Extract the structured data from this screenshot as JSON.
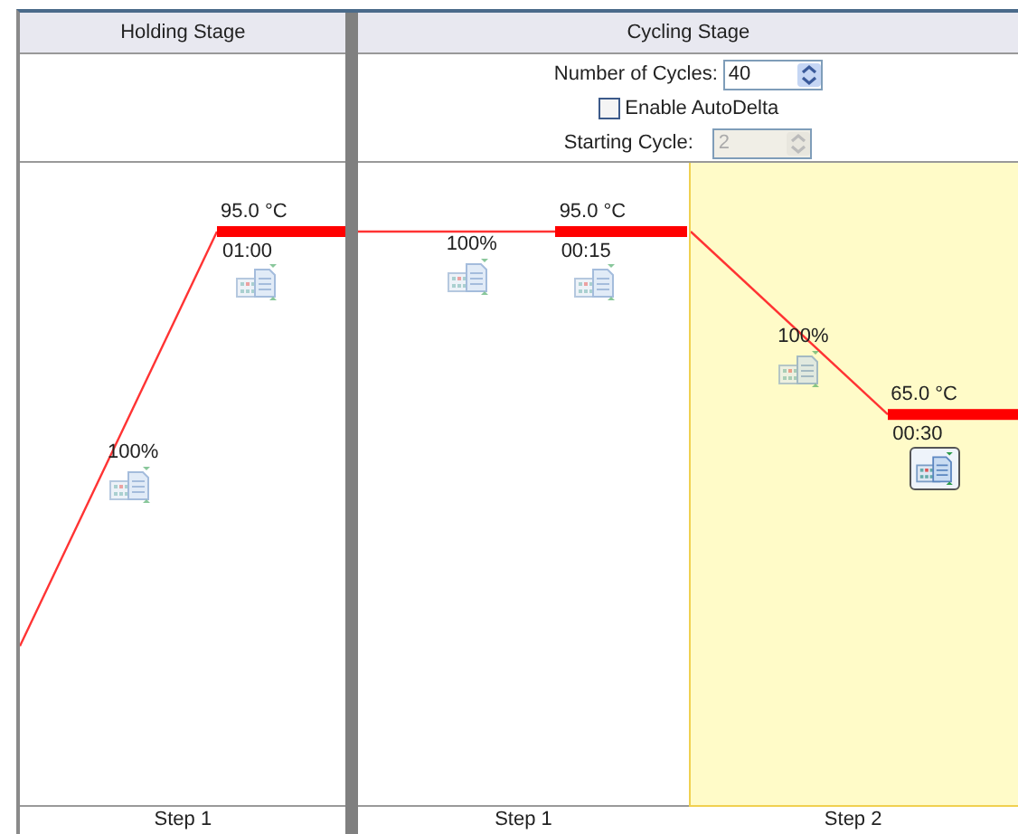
{
  "stages": [
    {
      "title": "Holding Stage",
      "steps": [
        {
          "label": "Step 1",
          "temperature": "95.0 °C",
          "time": "01:00",
          "ramp": "100%",
          "selected": false
        }
      ]
    },
    {
      "title": "Cycling Stage",
      "settings": {
        "cycles_label": "Number of Cycles:",
        "cycles": "40",
        "autodelta_label": "Enable AutoDelta",
        "autodelta_checked": false,
        "starting_cycle_label": "Starting Cycle:",
        "starting_cycle": "2",
        "starting_cycle_disabled": true
      },
      "steps": [
        {
          "label": "Step 1",
          "temperature": "95.0 °C",
          "time": "00:15",
          "ramp": "100%",
          "selected": false
        },
        {
          "label": "Step 2",
          "temperature": "65.0 °C",
          "time": "00:30",
          "ramp": "100%",
          "selected": true
        }
      ]
    }
  ]
}
